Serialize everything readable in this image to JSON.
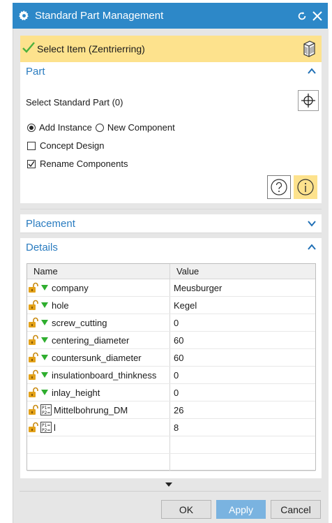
{
  "window": {
    "title": "Standard Part Management",
    "title_icon": "gear-icon",
    "reset_icon": "reset-icon",
    "close_icon": "close-icon"
  },
  "selection": {
    "label": "Select Item (Zentrierring)",
    "status_icon": "check-icon",
    "button_icon": "cube-icon"
  },
  "part_section": {
    "header": "Part",
    "select_label": "Select Standard Part (0)",
    "select_button_icon": "crosshair-icon",
    "radio_options": [
      {
        "label": "Add Instance",
        "checked": true
      },
      {
        "label": "New Component",
        "checked": false
      }
    ],
    "checkboxes": [
      {
        "label": "Concept Design",
        "checked": false
      },
      {
        "label": "Rename Components",
        "checked": true
      }
    ],
    "help_icon": "help-icon",
    "info_icon": "info-icon"
  },
  "placement_section": {
    "header": "Placement",
    "collapsed": true
  },
  "details_section": {
    "header": "Details",
    "columns": [
      "Name",
      "Value"
    ],
    "rows": [
      {
        "name": "company",
        "value": "Meusburger",
        "type": "expression"
      },
      {
        "name": "hole",
        "value": "Kegel",
        "type": "expression"
      },
      {
        "name": "screw_cutting",
        "value": "0",
        "type": "expression"
      },
      {
        "name": "centering_diameter",
        "value": "60",
        "type": "expression"
      },
      {
        "name": "countersunk_diameter",
        "value": "60",
        "type": "expression"
      },
      {
        "name": "insulationboard_thinkness",
        "value": "0",
        "type": "expression"
      },
      {
        "name": "inlay_height",
        "value": "0",
        "type": "expression"
      },
      {
        "name": "Mittelbohrung_DM",
        "value": "26",
        "type": "parameter"
      },
      {
        "name": "l",
        "value": "8",
        "type": "parameter"
      }
    ]
  },
  "buttons": {
    "ok": "OK",
    "apply": "Apply",
    "cancel": "Cancel"
  },
  "colors": {
    "titlebar": "#2d88c8",
    "selection_bar": "#fde28d",
    "section_header": "#2a7cc0",
    "apply_button": "#7ab3e0",
    "tree_arrow": "#2fae2f",
    "lock": "#e3a21a"
  }
}
